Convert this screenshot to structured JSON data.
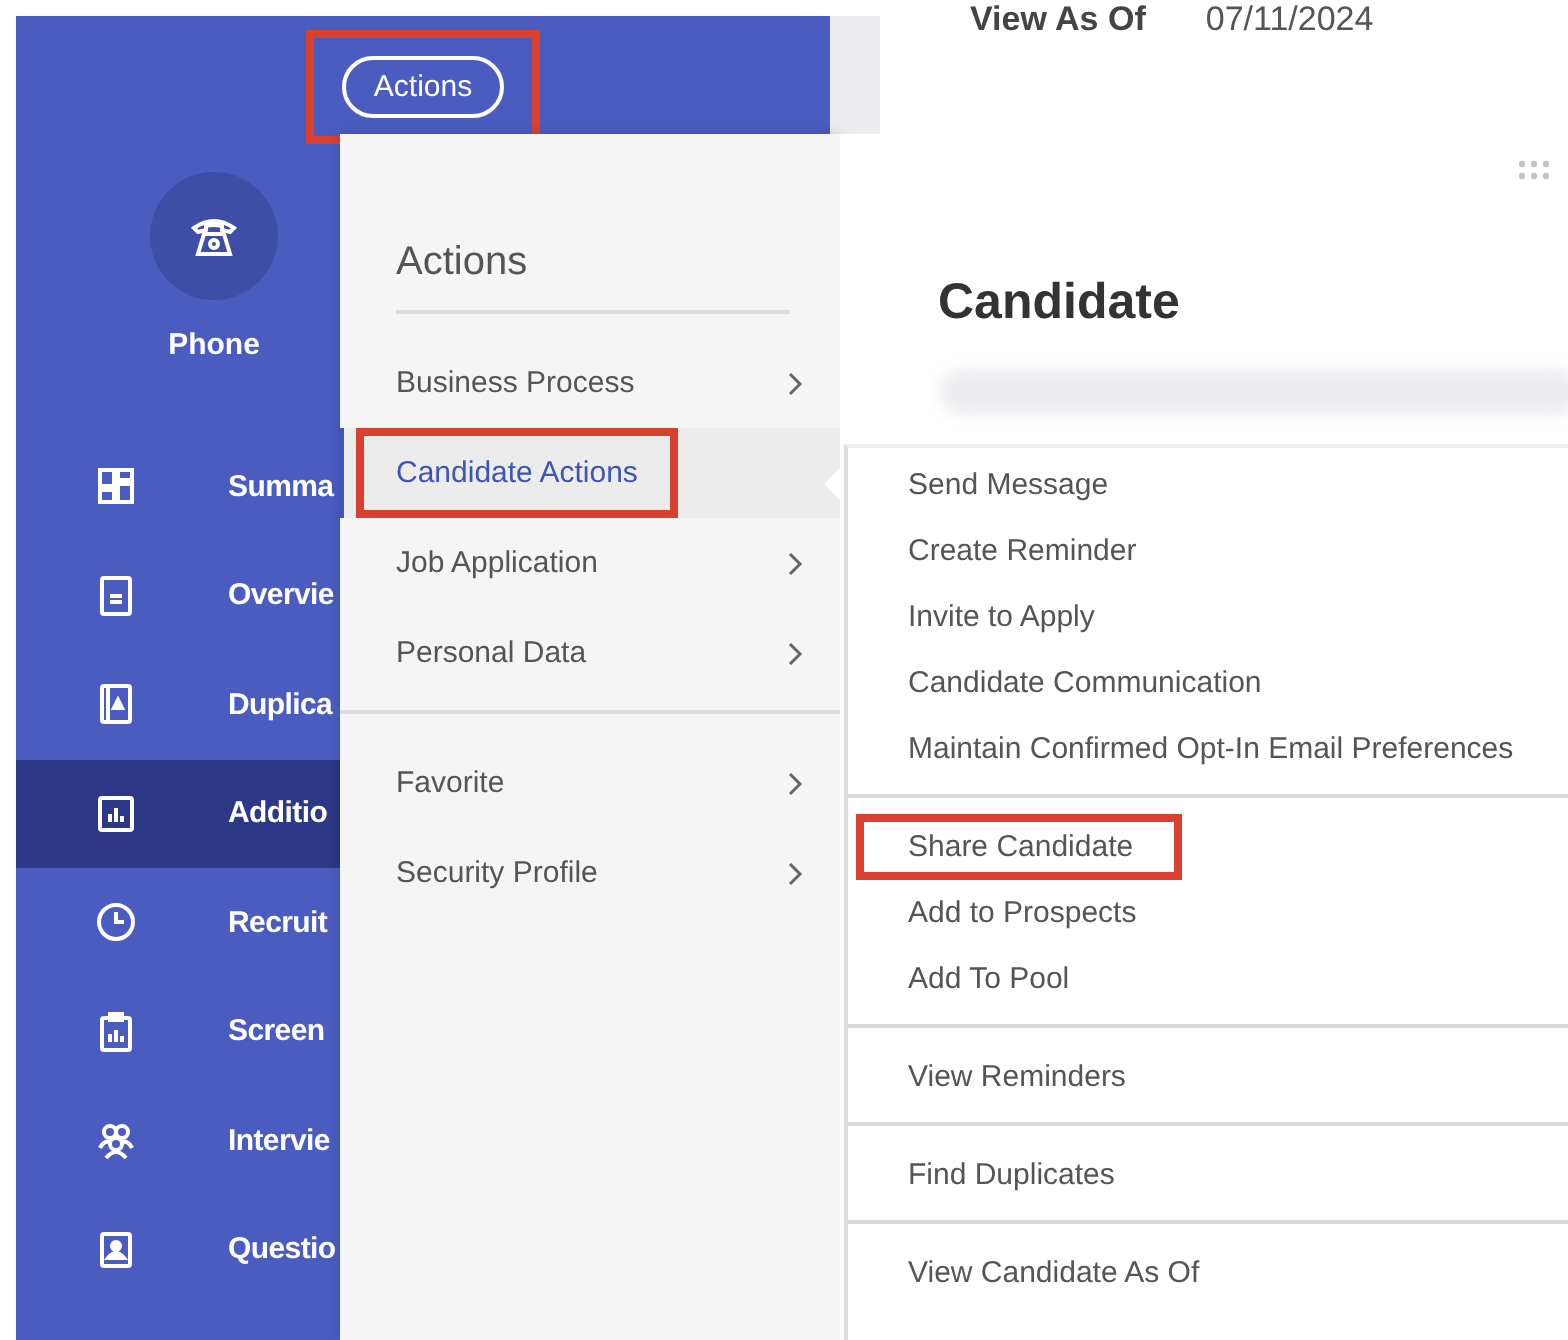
{
  "sidebar": {
    "actions_button": {
      "label": "Actions",
      "highlighted": true
    },
    "profile": {
      "label": "Phone"
    },
    "items": [
      {
        "kind": "grid",
        "label": "Summa",
        "selected": false
      },
      {
        "kind": "document",
        "label": "Overvie",
        "selected": false
      },
      {
        "kind": "contact",
        "label": "Duplica",
        "selected": false
      },
      {
        "kind": "chart",
        "label": "Additio",
        "selected": true
      },
      {
        "kind": "clock",
        "label": "Recruit",
        "selected": false
      },
      {
        "kind": "clipboard",
        "label": "Screen",
        "selected": false
      },
      {
        "kind": "people",
        "label": "Intervie",
        "selected": false
      },
      {
        "kind": "person",
        "label": "Questio",
        "selected": false
      }
    ]
  },
  "content": {
    "view_as_of_label": "View As Of",
    "view_as_of_date": "07/11/2024"
  },
  "actions_menu": {
    "title": "Actions",
    "groups": [
      [
        {
          "label": "Business Process",
          "selected": false,
          "highlighted": false,
          "submenu": true
        },
        {
          "label": "Candidate Actions",
          "selected": true,
          "highlighted": true,
          "submenu": false
        },
        {
          "label": "Job Application",
          "selected": false,
          "highlighted": false,
          "submenu": true
        },
        {
          "label": "Personal Data",
          "selected": false,
          "highlighted": false,
          "submenu": true
        }
      ],
      [
        {
          "label": "Favorite",
          "selected": false,
          "highlighted": false,
          "submenu": true
        },
        {
          "label": "Security Profile",
          "selected": false,
          "highlighted": false,
          "submenu": true
        }
      ]
    ]
  },
  "candidate_menu": {
    "title": "Candidate",
    "groups": [
      [
        {
          "label": "Send Message",
          "highlighted": false
        },
        {
          "label": "Create Reminder",
          "highlighted": false
        },
        {
          "label": "Invite to Apply",
          "highlighted": false
        },
        {
          "label": "Candidate Communication",
          "highlighted": false
        },
        {
          "label": "Maintain Confirmed Opt-In Email Preferences",
          "highlighted": false
        }
      ],
      [
        {
          "label": "Share Candidate",
          "highlighted": true
        },
        {
          "label": "Add to Prospects",
          "highlighted": false
        },
        {
          "label": "Add To Pool",
          "highlighted": false
        }
      ],
      [
        {
          "label": "View Reminders",
          "highlighted": false
        }
      ],
      [
        {
          "label": "Find Duplicates",
          "highlighted": false
        }
      ],
      [
        {
          "label": "View Candidate As Of",
          "highlighted": false
        }
      ]
    ]
  }
}
